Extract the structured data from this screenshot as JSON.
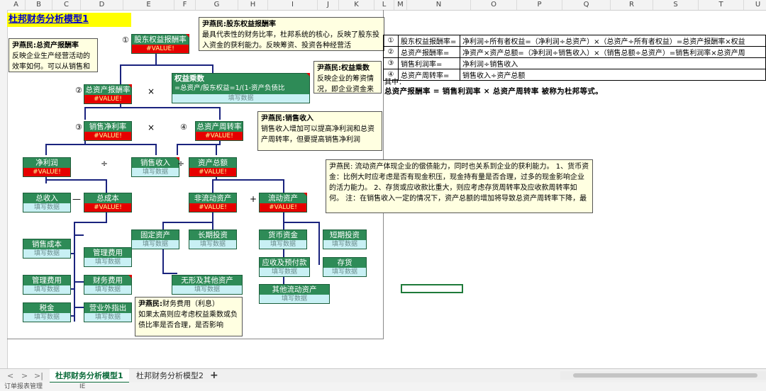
{
  "columns": [
    "A",
    "B",
    "C",
    "D",
    "E",
    "F",
    "G",
    "H",
    "I",
    "J",
    "K",
    "L",
    "M",
    "N",
    "O",
    "P",
    "Q",
    "R",
    "S",
    "T",
    "U"
  ],
  "title": "杜邦财务分析模型1",
  "nodes": {
    "roe": {
      "num": "①",
      "label": "股东权益报酬率",
      "value": "#VALUE!"
    },
    "roa": {
      "num": "②",
      "label": "总资产报酬率",
      "value": "#VALUE!"
    },
    "equity_multiplier": {
      "label": "权益乘数",
      "formula": "=总资产/股东权益=1/(1-资产负债比",
      "value": "填写数据"
    },
    "net_margin": {
      "num": "③",
      "label": "销售净利率",
      "value": "#VALUE!"
    },
    "asset_turnover": {
      "num": "④",
      "label": "总资产周转率",
      "value": "#VALUE!"
    },
    "net_profit": {
      "label": "净利润",
      "value": "#VALUE!"
    },
    "sales_a": {
      "label": "销售收入",
      "value": "填写数据"
    },
    "sales_b": {
      "label": "销售收入",
      "value": "填写数据"
    },
    "total_assets": {
      "label": "资产总额",
      "value": "#VALUE!"
    },
    "total_income": {
      "label": "总收入",
      "value": "填写数据"
    },
    "total_cost": {
      "label": "总成本",
      "value": "#VALUE!"
    },
    "noncurrent_assets": {
      "label": "非流动资产",
      "value": "#VALUE!"
    },
    "current_assets": {
      "label": "流动资产",
      "value": "#VALUE!"
    },
    "fixed_assets": {
      "label": "固定资产",
      "value": "填写数据"
    },
    "long_invest": {
      "label": "长期投资",
      "value": "填写数据"
    },
    "cash": {
      "label": "货币资金",
      "value": "填写数据"
    },
    "short_invest": {
      "label": "短期投资",
      "value": "填写数据"
    },
    "cogs": {
      "label": "销售成本",
      "value": "填写数据"
    },
    "mgmt_exp_a": {
      "label": "管理费用",
      "value": "填写数据"
    },
    "mgmt_exp_b": {
      "label": "管理费用",
      "value": "填写数据"
    },
    "fin_exp": {
      "label": "财务费用",
      "value": "填写数据"
    },
    "intangible": {
      "label": "无形及其他资产",
      "value": "填写数据"
    },
    "receivables": {
      "label": "应收及预付款",
      "value": "填写数据"
    },
    "inventory": {
      "label": "存货",
      "value": "填写数据"
    },
    "tax": {
      "label": "税金",
      "value": "填写数据"
    },
    "nonop_exp": {
      "label": "营业外指出",
      "value": "填写数据"
    },
    "other_current": {
      "label": "其他流动资产",
      "value": "填写数据"
    }
  },
  "operators": {
    "times": "×",
    "divide": "÷",
    "minus": "—",
    "plus": "+"
  },
  "notes": {
    "roe": {
      "title": "尹燕民:股东权益报酬率",
      "body": "最具代表性的财务比率，杜邦系统的核心，反映了股东投入资金的获利能力。反映筹资、投资各种经营活"
    },
    "roa": {
      "title": "尹燕民:总资产报酬率",
      "body": "反映企业生产经营活动的效率如何。可以从销售和"
    },
    "em": {
      "title": "尹燕民:权益乘数",
      "body": "反映企业的筹资情况，即企业资金来"
    },
    "sales": {
      "title": "尹燕民:销售收入",
      "body": "销售收入增加可以提高净利润和总资产周转率，但要提高销售净利润"
    },
    "current": {
      "body": "尹燕民: 流动资产体现企业的偿债能力，同时也关系到企业的获利能力。 1、货币资金：比例大时应考虑是否有现金积压，现金持有量是否合理，过多的现金影响企业的活力能力。 2、存货或应收款比重大，则应考虑存货周转率及应收款周转率如何。 注：在销售收入一定的情况下，资产总额的增加将导致总资产周转率下降，最"
    },
    "finexp": {
      "title": "尹燕民:",
      "title2": "财务费用（利息）",
      "body": "如果太高则应考虑权益乘数或负债比率是否合理，是否影响"
    }
  },
  "formula_table": [
    {
      "idx": "①",
      "name": "股东权益报酬率=",
      "formula": "净利润÷所有者权益=（净利润÷总资产）×（总资产÷所有者权益）=总资产报酬率×权益"
    },
    {
      "idx": "②",
      "name": "总资产报酬率=",
      "formula": "净资产×资产总额=（净利润÷销售收入）×（销售总额÷总资产）=销售利润率×总资产周"
    },
    {
      "idx": "③",
      "name": "销售利润率=",
      "formula": "净利润÷销售收入"
    },
    {
      "idx": "④",
      "name": "总资产周转率=",
      "formula": "销售收入÷资产总额"
    }
  ],
  "mid_label": "其中：",
  "summary": "总资产报酬率 = 销售利润率 × 总资产周转率 被称为杜邦等式。",
  "sheet_tabs": [
    {
      "label": "杜邦财务分析模型1",
      "active": true
    },
    {
      "label": "杜邦财务分析模型2",
      "active": false
    }
  ],
  "add_tab": "+",
  "nav": [
    "<",
    ">",
    ">|"
  ],
  "status": {
    "left": "订单报表管理",
    "mid": "IE",
    "colors": {
      "accent": "#2e8b57",
      "error": "#e60000",
      "fill": "#c8f0f4"
    }
  }
}
